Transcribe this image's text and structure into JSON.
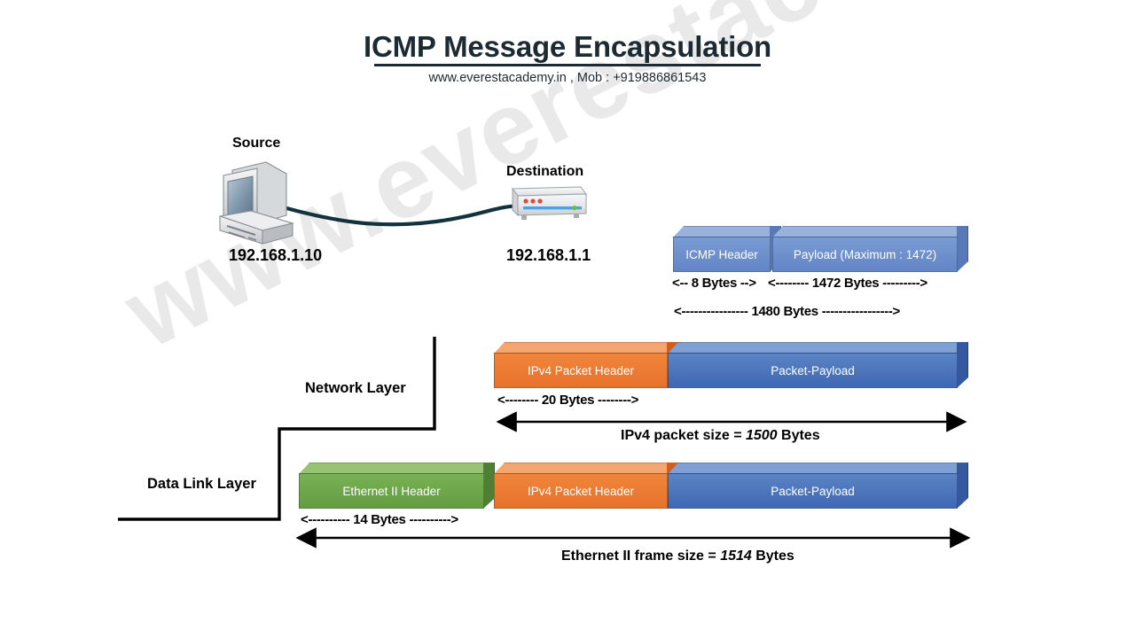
{
  "header": {
    "title": "ICMP Message Encapsulation",
    "subtitle": "www.everestacademy.in , Mob : +919886861543"
  },
  "watermark": {
    "text": "www.everestacademy.in"
  },
  "topology": {
    "source_label": "Source",
    "source_ip": "192.168.1.10",
    "destination_label": "Destination",
    "destination_ip": "192.168.1.1"
  },
  "layers": {
    "network": "Network Layer",
    "data_link": "Data Link Layer"
  },
  "icmp_row": {
    "header_label": "ICMP Header",
    "payload_label": "Payload (Maximum  : 1472)",
    "measure_header": "<-- 8 Bytes -->",
    "measure_payload": "<-------- 1472 Bytes --------->",
    "measure_total": "<---------------- 1480 Bytes ----------------->"
  },
  "ipv4_row": {
    "header_label": "IPv4 Packet Header",
    "payload_label": "Packet-Payload",
    "measure_header": "<-------- 20 Bytes -------->",
    "size_caption_pre": "IPv4 packet size = ",
    "size_caption_value": "1500",
    "size_caption_post": " Bytes"
  },
  "ethernet_row": {
    "eth_header_label": "Ethernet II Header",
    "ipv4_header_label": "IPv4 Packet Header",
    "payload_label": "Packet-Payload",
    "measure_header": "<---------- 14 Bytes ---------->",
    "size_caption_pre": "Ethernet II frame size = ",
    "size_caption_value": "1514",
    "size_caption_post": " Bytes"
  },
  "colors": {
    "icmp_blue": "#6285c6",
    "payload_blue": "#4472c4",
    "header_orange": "#ed7d31",
    "ethernet_green": "#70ad47",
    "title_dark": "#1b2a33",
    "line_black": "#000000",
    "watermark_gray": "#e9e9ea"
  },
  "chart_data": {
    "type": "diagram",
    "title": "ICMP Message Encapsulation",
    "rows": [
      {
        "name": "ICMP message",
        "segments": [
          {
            "label": "ICMP Header",
            "bytes": 8,
            "color": "#6285c6"
          },
          {
            "label": "Payload (Maximum  : 1472)",
            "bytes": 1472,
            "color": "#6285c6"
          }
        ],
        "total_bytes": 1480
      },
      {
        "name": "IPv4 packet",
        "segments": [
          {
            "label": "IPv4 Packet Header",
            "bytes": 20,
            "color": "#ed7d31"
          },
          {
            "label": "Packet-Payload",
            "bytes": 1480,
            "color": "#4472c4"
          }
        ],
        "total_bytes": 1500
      },
      {
        "name": "Ethernet II frame",
        "segments": [
          {
            "label": "Ethernet II Header",
            "bytes": 14,
            "color": "#70ad47"
          },
          {
            "label": "IPv4 Packet Header",
            "bytes": 20,
            "color": "#ed7d31"
          },
          {
            "label": "Packet-Payload",
            "bytes": 1480,
            "color": "#4472c4"
          }
        ],
        "total_bytes": 1514
      }
    ]
  }
}
